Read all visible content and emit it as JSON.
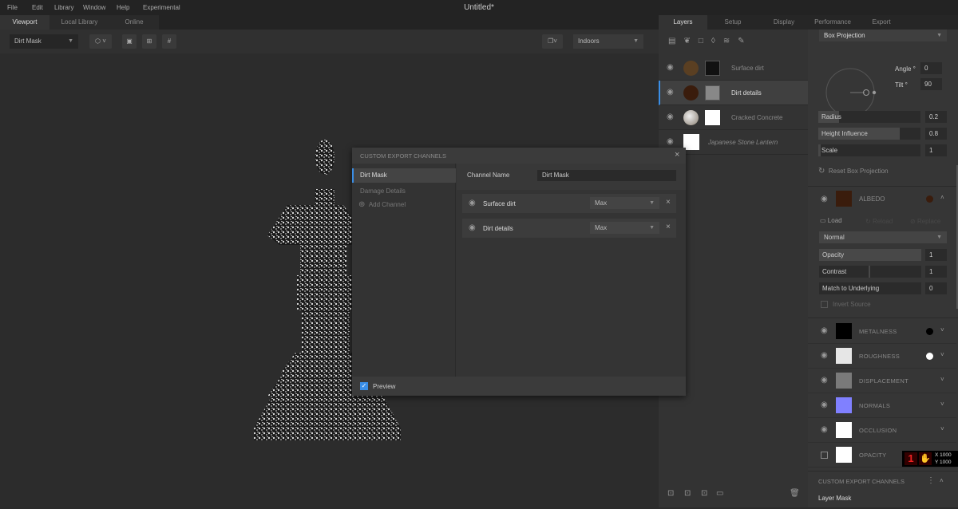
{
  "app": {
    "title": "Untitled*"
  },
  "menu": [
    "File",
    "Edit",
    "Library",
    "Window",
    "Help",
    "Experimental"
  ],
  "left_tabs": [
    "Viewport",
    "Local Library",
    "Online"
  ],
  "toolbar": {
    "channel_select": "Dirt Mask",
    "environment_select": "Indoors"
  },
  "right_tabs": [
    "Layers",
    "Setup",
    "Display",
    "Performance",
    "Export"
  ],
  "layers": [
    {
      "name": "Surface dirt",
      "color": "#5a3f22"
    },
    {
      "name": "Dirt details",
      "color": "#3a1c0c",
      "selected": true
    },
    {
      "name": "Cracked Concrete",
      "color": "#c9c2b8"
    },
    {
      "name": "Japanese Stone Lantern",
      "color": "#ffffff"
    }
  ],
  "projection": {
    "mode": "Box Projection",
    "angle_label": "Angle °",
    "angle": "0",
    "tilt_label": "Tilt °",
    "tilt": "90",
    "sliders": [
      {
        "label": "Radius",
        "value": "0.2",
        "fraction": 0.2
      },
      {
        "label": "Height Influence",
        "value": "0.8",
        "fraction": 0.8
      },
      {
        "label": "Scale",
        "value": "1",
        "fraction": 0.02
      }
    ],
    "reset": "Reset Box Projection"
  },
  "albedo": {
    "label": "ALBEDO",
    "color": "#3a1c0c",
    "load": "Load",
    "reload": "Reload",
    "replace": "Replace",
    "blend": "Normal",
    "sliders": [
      {
        "label": "Opacity",
        "value": "1",
        "fraction": 1
      },
      {
        "label": "Contrast",
        "value": "1",
        "fraction": 0.5
      },
      {
        "label": "Match to Underlying",
        "value": "0",
        "fraction": 0
      }
    ],
    "invert": "Invert Source"
  },
  "channels": [
    {
      "label": "METALNESS",
      "swatch": "#000000",
      "dot": "#000000"
    },
    {
      "label": "ROUGHNESS",
      "swatch": "#e6e6e6",
      "dot": "#ffffff"
    },
    {
      "label": "DISPLACEMENT",
      "swatch": "#7a7a7a"
    },
    {
      "label": "NORMALS",
      "swatch": "#8080ff"
    },
    {
      "label": "OCCLUSION",
      "swatch": "#ffffff"
    },
    {
      "label": "OPACITY",
      "swatch": "#ffffff"
    }
  ],
  "overlay": {
    "x": "X 1000",
    "y": "Y 1000",
    "digits": "1"
  },
  "custom_export": {
    "header": "CUSTOM EXPORT CHANNELS",
    "item": "Layer Mask"
  },
  "dialog": {
    "title": "CUSTOM EXPORT CHANNELS",
    "channels": [
      "Dirt Mask",
      "Damage Details"
    ],
    "add": "Add Channel",
    "name_label": "Channel Name",
    "name_value": "Dirt Mask",
    "sources": [
      {
        "name": "Surface dirt",
        "mode": "Max"
      },
      {
        "name": "Dirt details",
        "mode": "Max"
      }
    ],
    "preview": "Preview"
  }
}
